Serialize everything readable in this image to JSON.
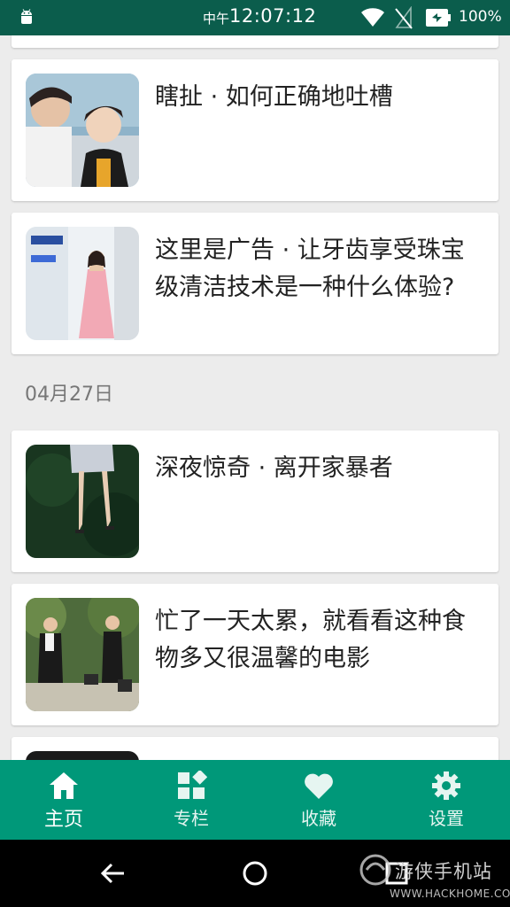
{
  "status_bar": {
    "time_prefix": "中午",
    "time": "12:07:12",
    "battery": "100%",
    "icons": [
      "android-icon",
      "wifi-icon",
      "no-signal-icon",
      "battery-charging-icon"
    ]
  },
  "feed": {
    "cards": [
      {
        "title": "瞎扯 · 如何正确地吐槽",
        "thumbnail": "two-people-photo"
      },
      {
        "title": "这里是广告 · 让牙齿享受珠宝级清洁技术是一种什么体验?",
        "thumbnail": "philips-ad-photo"
      },
      {
        "title": "深夜惊奇 · 离开家暴者",
        "thumbnail": "legs-on-grass-photo"
      },
      {
        "title": "忙了一天太累，就看看这种食物多又很温馨的电影",
        "thumbnail": "two-women-walking-photo"
      }
    ],
    "date_header": "04月27日"
  },
  "bottom_nav": {
    "items": [
      {
        "label": "主页",
        "icon": "home-icon",
        "active": true
      },
      {
        "label": "专栏",
        "icon": "columns-icon",
        "active": false
      },
      {
        "label": "收藏",
        "icon": "heart-icon",
        "active": false
      },
      {
        "label": "设置",
        "icon": "gear-icon",
        "active": false
      }
    ]
  },
  "watermark": {
    "text": "游侠手机站",
    "url": "WWW.HACKHOME.COM"
  },
  "colors": {
    "status_bar": "#0b5d4c",
    "bottom_nav": "#009879",
    "background": "#ececec"
  }
}
